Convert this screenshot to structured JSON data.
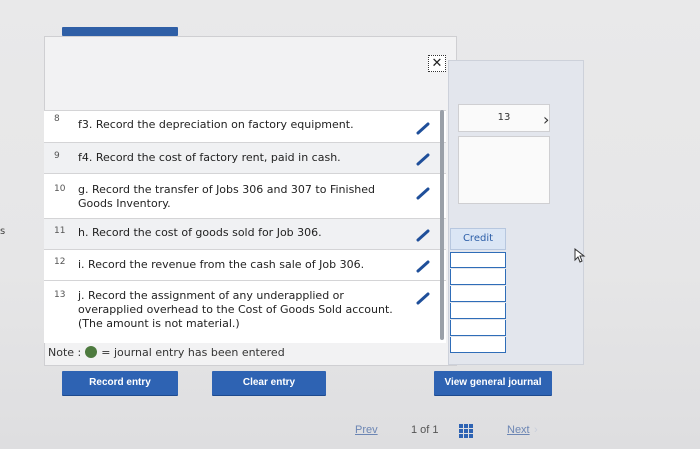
{
  "left_edge_mark": "s",
  "close_icon": "x-icon",
  "right_panel": {
    "top_value": "13",
    "credit_label": "Credit",
    "chevron": "chevron-right-icon"
  },
  "rows": [
    {
      "num": "8",
      "text": "f3. Record the depreciation on factory equipment."
    },
    {
      "num": "9",
      "text": "f4. Record the cost of factory rent, paid in cash."
    },
    {
      "num": "10",
      "text": "g. Record the transfer of Jobs 306 and 307 to Finished Goods Inventory."
    },
    {
      "num": "11",
      "text": "h. Record the cost of goods sold for Job 306."
    },
    {
      "num": "12",
      "text": "i. Record the revenue from the cash sale of Job 306."
    },
    {
      "num": "13",
      "text": "j. Record the assignment of any underapplied or overapplied overhead to the Cost of Goods Sold account. (The amount is not material.)"
    }
  ],
  "note": {
    "prefix": "Note :",
    "suffix": "= journal entry has been entered",
    "dot_color": "#4d7a3e"
  },
  "buttons": {
    "record": "Record entry",
    "clear": "Clear entry",
    "view": "View general journal"
  },
  "pager": {
    "prev": "Prev",
    "count": "1 of 1",
    "next": "Next"
  },
  "colors": {
    "accent": "#2e63b3",
    "pencil": "#1f4f9a"
  }
}
